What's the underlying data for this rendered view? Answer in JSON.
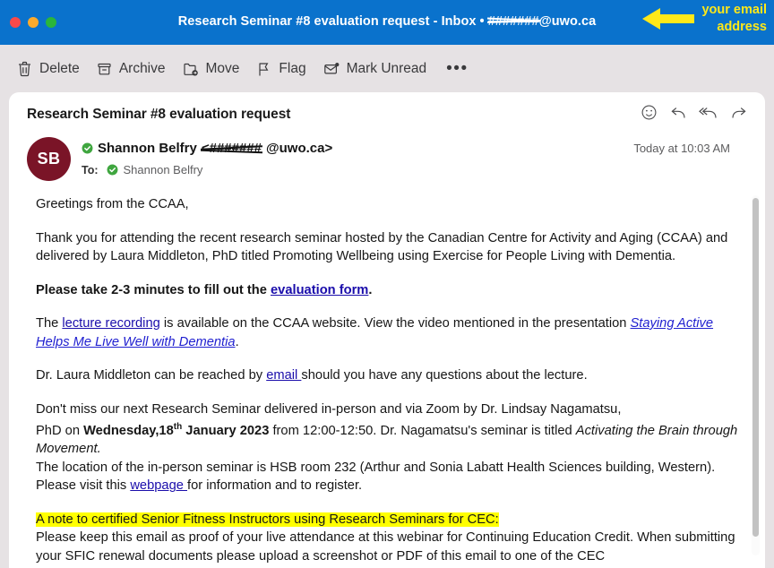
{
  "window": {
    "title_prefix": "Research Seminar #8 evaluation request - Inbox • ",
    "redacted_user": "#######",
    "email_domain": "@uwo.ca",
    "titlebar_color": "#0a72cc",
    "traffic_lights": [
      "close-red",
      "minimize-yellow",
      "maximize-green"
    ]
  },
  "annotation": {
    "text": "your email\naddress",
    "color": "#ffe819",
    "arrow": "left-arrow"
  },
  "toolbar": {
    "items": [
      {
        "label": "Delete",
        "icon": "trash-icon"
      },
      {
        "label": "Archive",
        "icon": "archive-box-icon"
      },
      {
        "label": "Move",
        "icon": "folder-move-icon"
      },
      {
        "label": "Flag",
        "icon": "flag-icon"
      },
      {
        "label": "Mark Unread",
        "icon": "envelope-dot-icon"
      }
    ],
    "more_label": "•••"
  },
  "message": {
    "subject": "Research Seminar #8 evaluation request",
    "avatar_initials": "SB",
    "avatar_color": "#7a1427",
    "sender_name": "Shannon Belfry",
    "sender_email_redacted": "<#######",
    "sender_email_domain": "@uwo.ca>",
    "to_label": "To:",
    "to_name": "Shannon Belfry",
    "timestamp": "Today at 10:03 AM",
    "actions": [
      {
        "name": "react-emoji-icon"
      },
      {
        "name": "reply-icon"
      },
      {
        "name": "reply-all-icon"
      },
      {
        "name": "forward-icon"
      }
    ]
  },
  "body": {
    "greeting": "Greetings from the CCAA,",
    "para_thanks": "Thank you for attending the recent research seminar hosted by the Canadian Centre for Activity and Aging (CCAA) and delivered by Laura Middleton, PhD titled Promoting Wellbeing using Exercise for People Living with Dementia.",
    "para_eval_pre": "Please take 2-3 minutes to fill out the ",
    "link_eval": "evaluation form",
    "para_eval_post": ".",
    "para_rec_pre": "The ",
    "link_recording": "lecture recording",
    "para_rec_mid": " is available on the CCAA website. View the video mentioned in the presentation ",
    "link_video": "Staying Active Helps Me Live Well with Dementia",
    "para_rec_post": ".",
    "para_contact_pre": "Dr. Laura Middleton can be reached by ",
    "link_email": "email ",
    "para_contact_post": "should you have any questions about the lecture.",
    "para_next_1": "Don't miss our next Research Seminar delivered in-person and via Zoom by Dr. Lindsay Nagamatsu,",
    "para_next_2_pre": "PhD on ",
    "para_next_date_bold": "Wednesday,18",
    "para_next_date_sup": "th",
    "para_next_date_bold2": " January 2023",
    "para_next_2_mid": " from 12:00-12:50. Dr. Nagamatsu's seminar is titled ",
    "para_next_italic": "Activating the Brain through Movement.",
    "para_location": "The location of the in-person seminar is HSB room 232 (Arthur and Sonia Labatt Health Sciences building, Western).",
    "para_register_pre": "Please visit this ",
    "link_webpage": "webpage ",
    "para_register_post": "for information and to register.",
    "highlighted_note": "A note to certified Senior Fitness Instructors using Research Seminars for CEC:",
    "para_cec": "Please keep this email as proof of your live attendance at this webinar for Continuing Education Credit. When submitting your SFIC renewal documents please upload a screenshot or PDF of this email to one of the CEC"
  }
}
